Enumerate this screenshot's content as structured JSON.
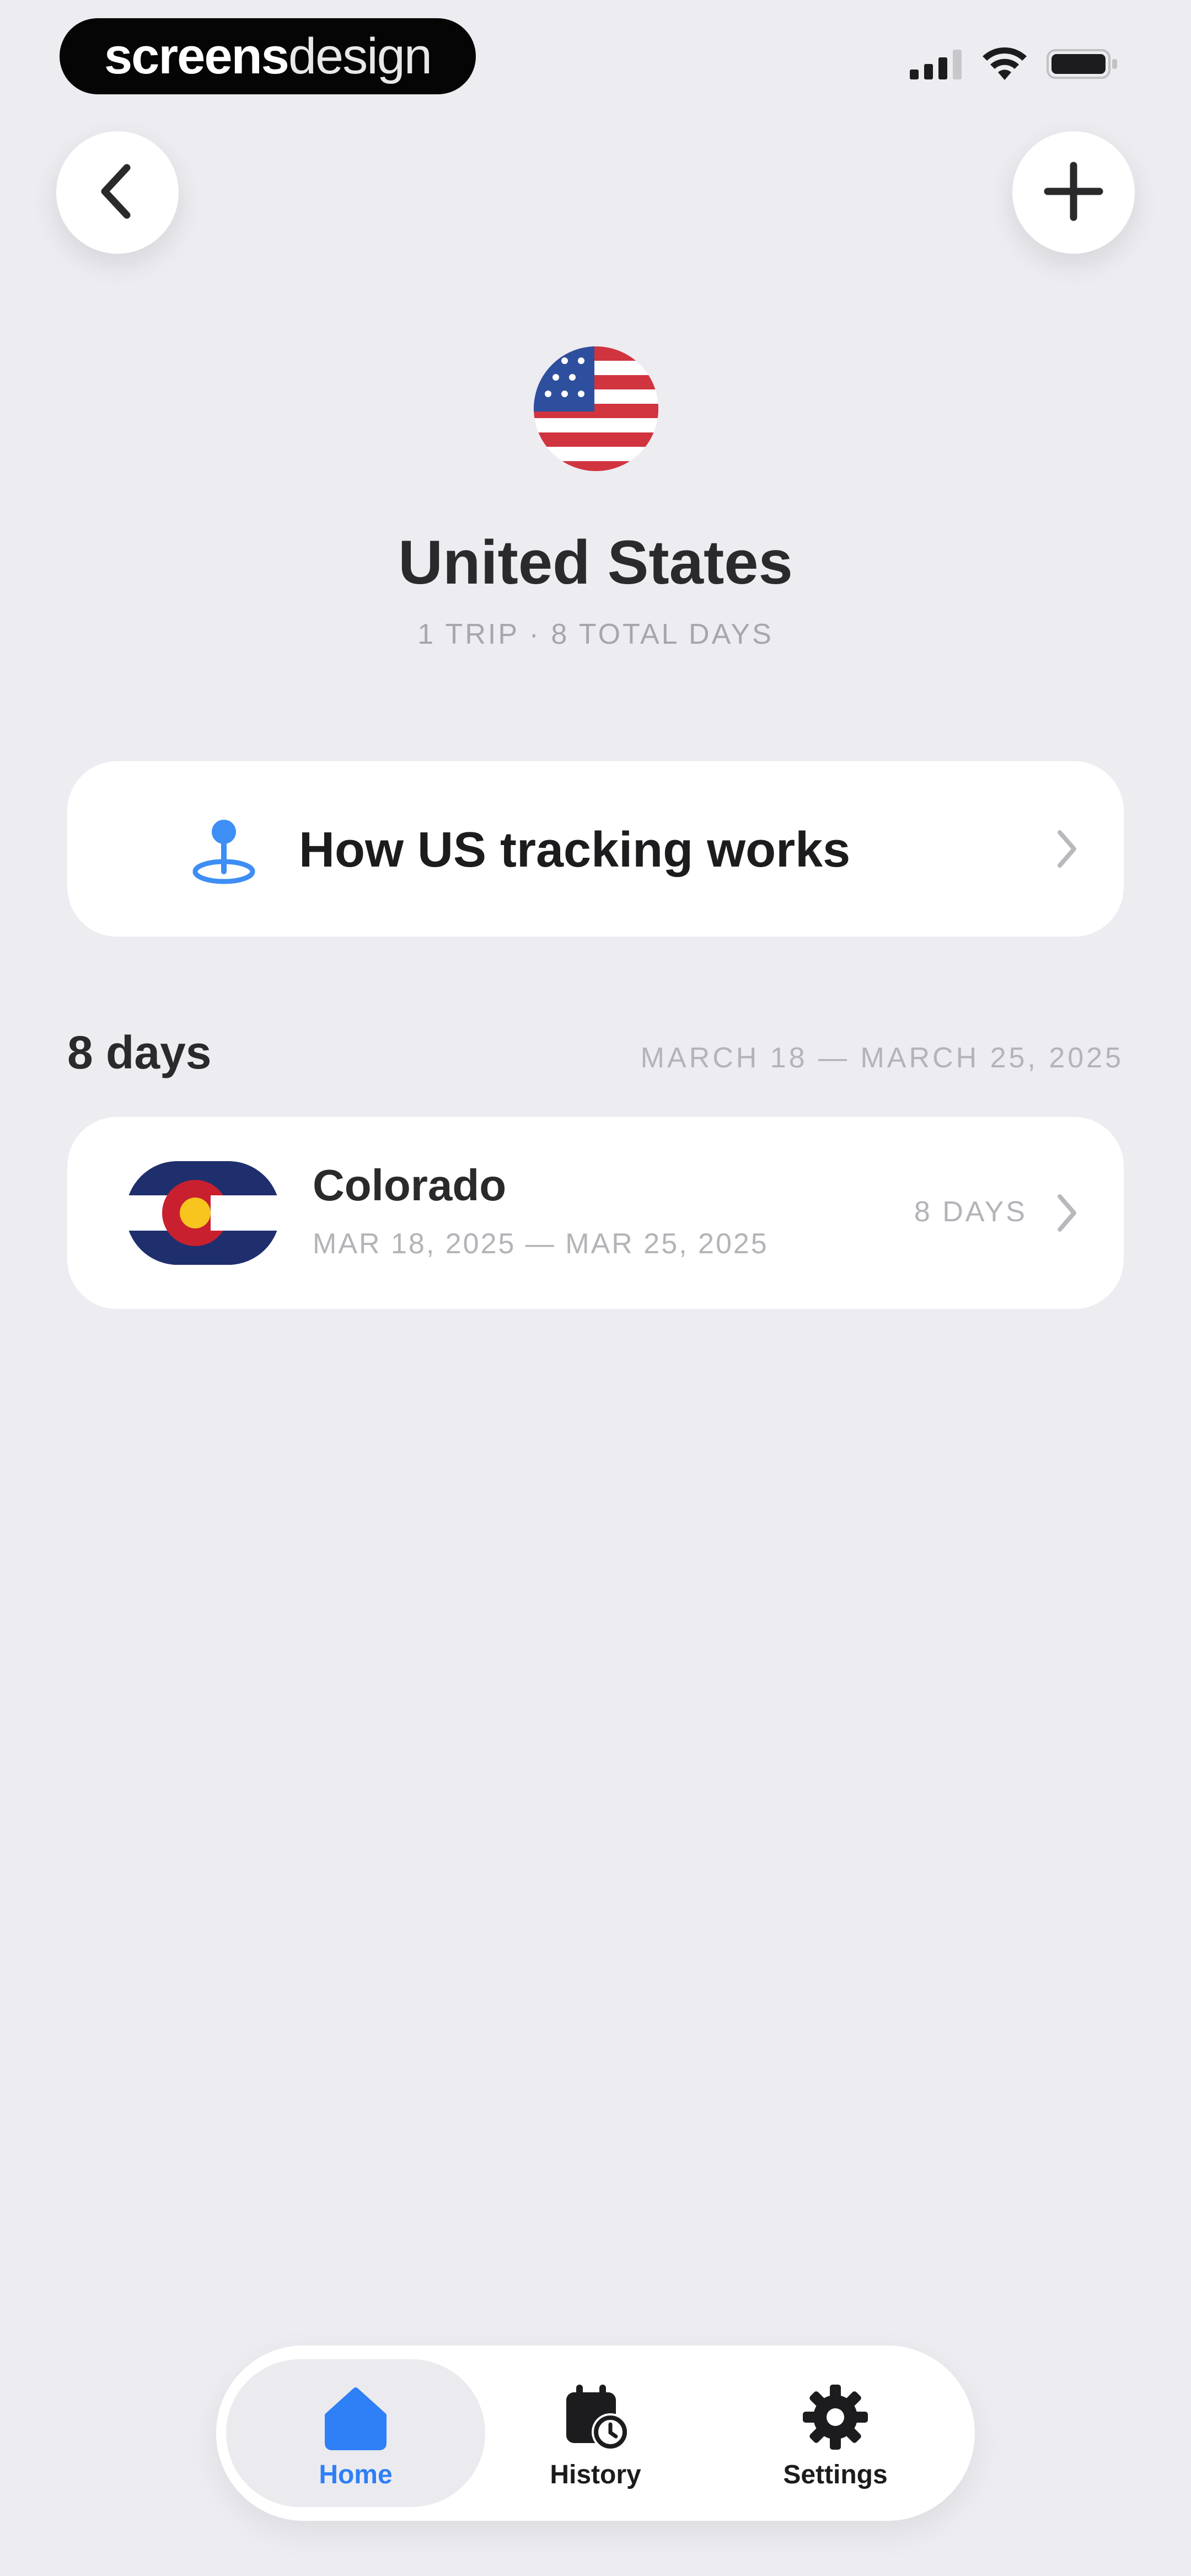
{
  "status_bar": {
    "watermark_bold": "screens",
    "watermark_light": "design",
    "icons": [
      "cellular-signal-icon",
      "wifi-icon",
      "battery-icon"
    ]
  },
  "header": {
    "back_icon": "chevron-left-icon",
    "add_icon": "plus-icon"
  },
  "country": {
    "flag_icon": "us-flag-icon",
    "name": "United States",
    "summary": "1 TRIP · 8 TOTAL DAYS"
  },
  "info_card": {
    "icon": "location-pin-icon",
    "label": "How US tracking works"
  },
  "section": {
    "total_label": "8 days",
    "date_range": "MARCH 18 — MARCH 25, 2025"
  },
  "trips": [
    {
      "flag_icon": "colorado-flag-icon",
      "name": "Colorado",
      "dates": "MAR 18, 2025 — MAR 25, 2025",
      "days": "8 DAYS"
    }
  ],
  "tabbar": {
    "tabs": [
      {
        "label": "Home",
        "icon": "home-icon",
        "active": true
      },
      {
        "label": "History",
        "icon": "calendar-clock-icon",
        "active": false
      },
      {
        "label": "Settings",
        "icon": "gear-icon",
        "active": false
      }
    ]
  },
  "colors": {
    "background": "#edecf1",
    "card": "#ffffff",
    "accent": "#2f7ff6",
    "muted_text": "#b3b3b8"
  }
}
